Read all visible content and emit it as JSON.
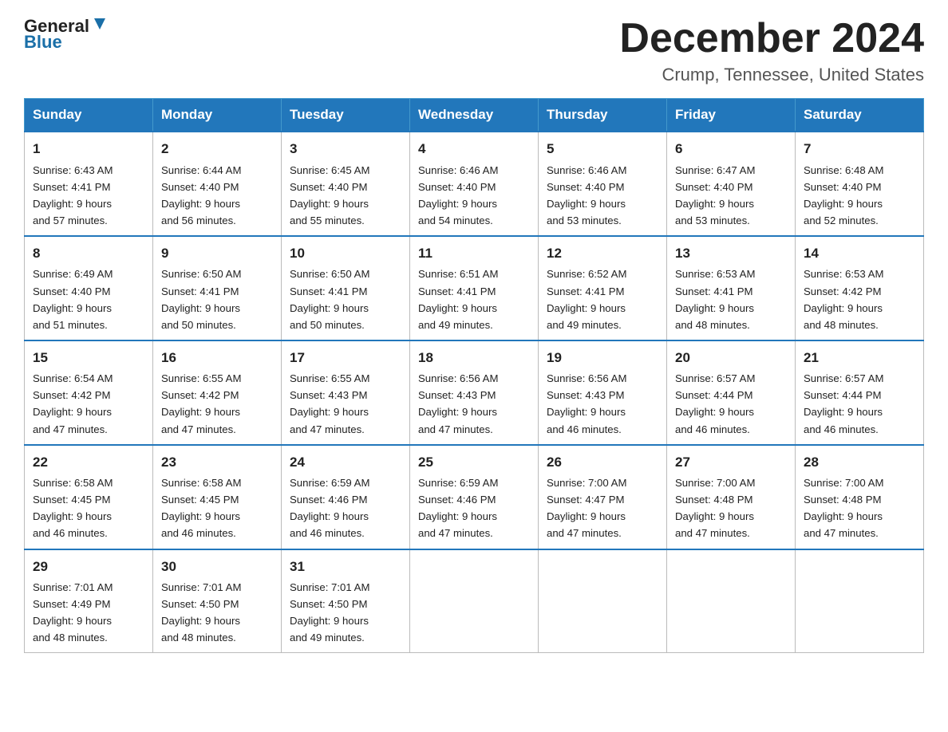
{
  "header": {
    "logo_text_black": "General",
    "logo_text_blue": "Blue",
    "month_title": "December 2024",
    "location": "Crump, Tennessee, United States"
  },
  "days_of_week": [
    "Sunday",
    "Monday",
    "Tuesday",
    "Wednesday",
    "Thursday",
    "Friday",
    "Saturday"
  ],
  "weeks": [
    [
      {
        "day": "1",
        "sunrise": "6:43 AM",
        "sunset": "4:41 PM",
        "daylight": "9 hours and 57 minutes."
      },
      {
        "day": "2",
        "sunrise": "6:44 AM",
        "sunset": "4:40 PM",
        "daylight": "9 hours and 56 minutes."
      },
      {
        "day": "3",
        "sunrise": "6:45 AM",
        "sunset": "4:40 PM",
        "daylight": "9 hours and 55 minutes."
      },
      {
        "day": "4",
        "sunrise": "6:46 AM",
        "sunset": "4:40 PM",
        "daylight": "9 hours and 54 minutes."
      },
      {
        "day": "5",
        "sunrise": "6:46 AM",
        "sunset": "4:40 PM",
        "daylight": "9 hours and 53 minutes."
      },
      {
        "day": "6",
        "sunrise": "6:47 AM",
        "sunset": "4:40 PM",
        "daylight": "9 hours and 53 minutes."
      },
      {
        "day": "7",
        "sunrise": "6:48 AM",
        "sunset": "4:40 PM",
        "daylight": "9 hours and 52 minutes."
      }
    ],
    [
      {
        "day": "8",
        "sunrise": "6:49 AM",
        "sunset": "4:40 PM",
        "daylight": "9 hours and 51 minutes."
      },
      {
        "day": "9",
        "sunrise": "6:50 AM",
        "sunset": "4:41 PM",
        "daylight": "9 hours and 50 minutes."
      },
      {
        "day": "10",
        "sunrise": "6:50 AM",
        "sunset": "4:41 PM",
        "daylight": "9 hours and 50 minutes."
      },
      {
        "day": "11",
        "sunrise": "6:51 AM",
        "sunset": "4:41 PM",
        "daylight": "9 hours and 49 minutes."
      },
      {
        "day": "12",
        "sunrise": "6:52 AM",
        "sunset": "4:41 PM",
        "daylight": "9 hours and 49 minutes."
      },
      {
        "day": "13",
        "sunrise": "6:53 AM",
        "sunset": "4:41 PM",
        "daylight": "9 hours and 48 minutes."
      },
      {
        "day": "14",
        "sunrise": "6:53 AM",
        "sunset": "4:42 PM",
        "daylight": "9 hours and 48 minutes."
      }
    ],
    [
      {
        "day": "15",
        "sunrise": "6:54 AM",
        "sunset": "4:42 PM",
        "daylight": "9 hours and 47 minutes."
      },
      {
        "day": "16",
        "sunrise": "6:55 AM",
        "sunset": "4:42 PM",
        "daylight": "9 hours and 47 minutes."
      },
      {
        "day": "17",
        "sunrise": "6:55 AM",
        "sunset": "4:43 PM",
        "daylight": "9 hours and 47 minutes."
      },
      {
        "day": "18",
        "sunrise": "6:56 AM",
        "sunset": "4:43 PM",
        "daylight": "9 hours and 47 minutes."
      },
      {
        "day": "19",
        "sunrise": "6:56 AM",
        "sunset": "4:43 PM",
        "daylight": "9 hours and 46 minutes."
      },
      {
        "day": "20",
        "sunrise": "6:57 AM",
        "sunset": "4:44 PM",
        "daylight": "9 hours and 46 minutes."
      },
      {
        "day": "21",
        "sunrise": "6:57 AM",
        "sunset": "4:44 PM",
        "daylight": "9 hours and 46 minutes."
      }
    ],
    [
      {
        "day": "22",
        "sunrise": "6:58 AM",
        "sunset": "4:45 PM",
        "daylight": "9 hours and 46 minutes."
      },
      {
        "day": "23",
        "sunrise": "6:58 AM",
        "sunset": "4:45 PM",
        "daylight": "9 hours and 46 minutes."
      },
      {
        "day": "24",
        "sunrise": "6:59 AM",
        "sunset": "4:46 PM",
        "daylight": "9 hours and 46 minutes."
      },
      {
        "day": "25",
        "sunrise": "6:59 AM",
        "sunset": "4:46 PM",
        "daylight": "9 hours and 47 minutes."
      },
      {
        "day": "26",
        "sunrise": "7:00 AM",
        "sunset": "4:47 PM",
        "daylight": "9 hours and 47 minutes."
      },
      {
        "day": "27",
        "sunrise": "7:00 AM",
        "sunset": "4:48 PM",
        "daylight": "9 hours and 47 minutes."
      },
      {
        "day": "28",
        "sunrise": "7:00 AM",
        "sunset": "4:48 PM",
        "daylight": "9 hours and 47 minutes."
      }
    ],
    [
      {
        "day": "29",
        "sunrise": "7:01 AM",
        "sunset": "4:49 PM",
        "daylight": "9 hours and 48 minutes."
      },
      {
        "day": "30",
        "sunrise": "7:01 AM",
        "sunset": "4:50 PM",
        "daylight": "9 hours and 48 minutes."
      },
      {
        "day": "31",
        "sunrise": "7:01 AM",
        "sunset": "4:50 PM",
        "daylight": "9 hours and 49 minutes."
      },
      null,
      null,
      null,
      null
    ]
  ]
}
